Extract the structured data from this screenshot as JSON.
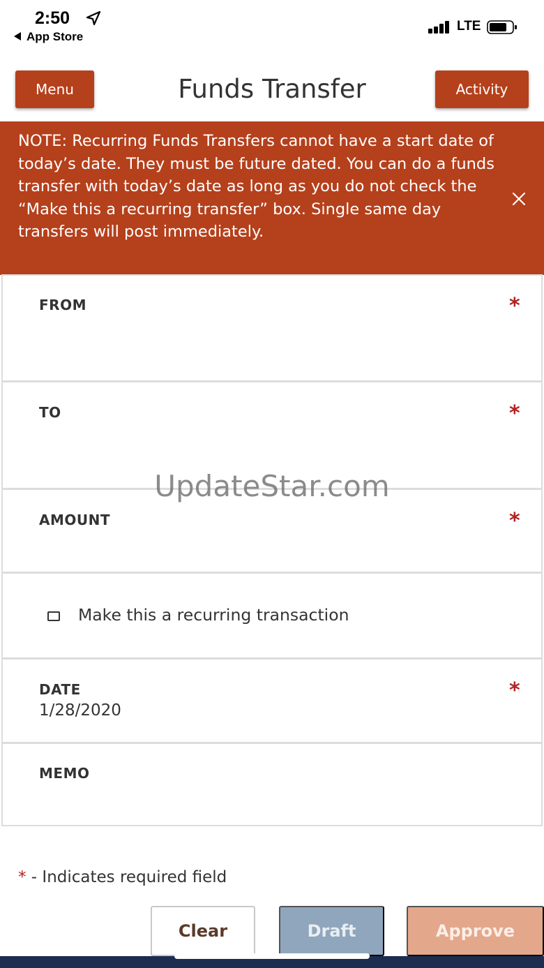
{
  "status_bar": {
    "time": "2:50",
    "back_app": "App Store",
    "network": "LTE"
  },
  "header": {
    "menu_label": "Menu",
    "title": "Funds Transfer",
    "activity_label": "Activity"
  },
  "notice": {
    "text": "NOTE: Recurring Funds Transfers cannot have a start date of today’s date. They must be future dated. You can do a funds transfer with today’s date as long as you do not check the “Make this a recurring transfer” box. Single same day transfers will post immediately."
  },
  "form": {
    "from_label": "FROM",
    "to_label": "TO",
    "amount_label": "AMOUNT",
    "recurring_label": "Make this a recurring transaction",
    "recurring_checked": false,
    "date_label": "DATE",
    "date_value": "1/28/2020",
    "memo_label": "MEMO",
    "required_marker": "*"
  },
  "watermark": "UpdateStar.com",
  "legend": {
    "star": "*",
    "text": " - Indicates required field"
  },
  "actions": {
    "clear_label": "Clear",
    "draft_label": "Draft",
    "approve_label": "Approve"
  },
  "colors": {
    "brand": "#b5401c",
    "required": "#b22222",
    "draft_disabled": "#90a6bd",
    "approve_disabled": "#e3a88b",
    "bottom_bar": "#1c2d4f"
  }
}
